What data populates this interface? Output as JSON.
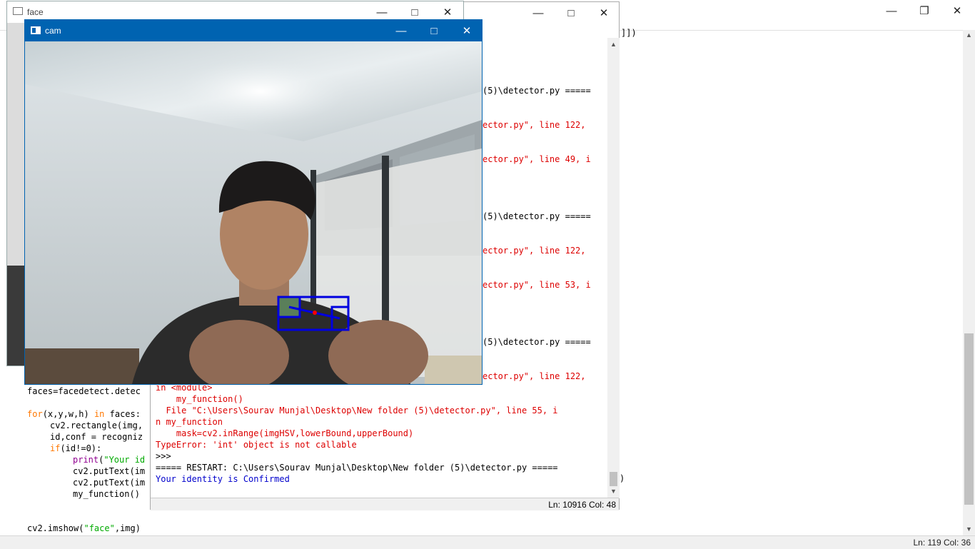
{
  "background_editor": {
    "code_lines": [
      {
        "indent": 0,
        "parts": [
          {
            "t": "faces=facedetect.detec",
            "c": ""
          }
        ]
      },
      {
        "indent": 0,
        "parts": [
          {
            "t": "",
            "c": ""
          }
        ]
      },
      {
        "indent": 0,
        "parts": [
          {
            "t": "for",
            "c": "kw"
          },
          {
            "t": "(x,y,w,h) ",
            "c": ""
          },
          {
            "t": "in",
            "c": "kw"
          },
          {
            "t": " faces:",
            "c": ""
          }
        ]
      },
      {
        "indent": 1,
        "parts": [
          {
            "t": "cv2.rectangle(img,",
            "c": ""
          }
        ]
      },
      {
        "indent": 1,
        "parts": [
          {
            "t": "id,conf = recogniz",
            "c": ""
          }
        ]
      },
      {
        "indent": 1,
        "parts": [
          {
            "t": "if",
            "c": "kw"
          },
          {
            "t": "(id!=0):",
            "c": ""
          }
        ]
      },
      {
        "indent": 2,
        "parts": [
          {
            "t": "print",
            "c": "bi"
          },
          {
            "t": "(",
            "c": ""
          },
          {
            "t": "\"Your id",
            "c": "st"
          }
        ]
      },
      {
        "indent": 2,
        "parts": [
          {
            "t": "cv2.putText(im",
            "c": ""
          }
        ]
      },
      {
        "indent": 2,
        "parts": [
          {
            "t": "cv2.putText(im",
            "c": ""
          }
        ]
      },
      {
        "indent": 2,
        "parts": [
          {
            "t": "my_function()",
            "c": ""
          }
        ]
      },
      {
        "indent": 0,
        "parts": [
          {
            "t": "",
            "c": ""
          }
        ]
      },
      {
        "indent": 0,
        "parts": [
          {
            "t": "",
            "c": ""
          }
        ]
      },
      {
        "indent": 0,
        "parts": [
          {
            "t": "cv2.imshow(",
            "c": ""
          },
          {
            "t": "\"face\"",
            "c": "st"
          },
          {
            "t": ",img)",
            "c": ""
          }
        ]
      }
    ],
    "right_fragment_top": "]])",
    "right_fragment_bottom": ")",
    "status": "Ln: 119   Col: 36"
  },
  "shell": {
    "lines": [
      {
        "t": "(5)\\detector.py =====",
        "c": "",
        "cam_hidden": true
      },
      {
        "t": "",
        "c": ""
      },
      {
        "t": "",
        "c": ""
      },
      {
        "t": "ector.py\", line 122,",
        "c": "red",
        "cam_hidden": true
      },
      {
        "t": "",
        "c": ""
      },
      {
        "t": "",
        "c": ""
      },
      {
        "t": "ector.py\", line 49, i",
        "c": "red",
        "cam_hidden": true
      },
      {
        "t": "",
        "c": ""
      },
      {
        "t": "",
        "c": ""
      },
      {
        "t": "",
        "c": ""
      },
      {
        "t": "",
        "c": ""
      },
      {
        "t": "(5)\\detector.py =====",
        "c": "",
        "cam_hidden": true
      },
      {
        "t": "",
        "c": ""
      },
      {
        "t": "",
        "c": ""
      },
      {
        "t": "ector.py\", line 122,",
        "c": "red",
        "cam_hidden": true
      },
      {
        "t": "",
        "c": ""
      },
      {
        "t": "",
        "c": ""
      },
      {
        "t": "ector.py\", line 53, i",
        "c": "red",
        "cam_hidden": true
      },
      {
        "t": "",
        "c": ""
      },
      {
        "t": "",
        "c": ""
      },
      {
        "t": "",
        "c": ""
      },
      {
        "t": "",
        "c": ""
      },
      {
        "t": "(5)\\detector.py =====",
        "c": "",
        "cam_hidden": true
      },
      {
        "t": "",
        "c": ""
      },
      {
        "t": "",
        "c": ""
      },
      {
        "t": "ector.py\", line 122,",
        "c": "red",
        "cam_hidden": true
      },
      {
        "t": "in <module>",
        "c": "red"
      },
      {
        "t": "    my_function()",
        "c": "red"
      },
      {
        "t": "  File \"C:\\Users\\Sourav Munjal\\Desktop\\New folder (5)\\detector.py\", line 55, i",
        "c": "red"
      },
      {
        "t": "n my_function",
        "c": "red"
      },
      {
        "t": "    mask=cv2.inRange(imgHSV,lowerBound,upperBound)",
        "c": "red"
      },
      {
        "t": "TypeError: 'int' object is not callable",
        "c": "red"
      },
      {
        "t": ">>>",
        "c": ""
      },
      {
        "t": "===== RESTART: C:\\Users\\Sourav Munjal\\Desktop\\New folder (5)\\detector.py =====",
        "c": ""
      },
      {
        "t": "Your identity is Confirmed",
        "c": "blue"
      }
    ],
    "status": "Ln: 10916   Col: 48"
  },
  "face_window": {
    "title": "face"
  },
  "cam_window": {
    "title": "cam"
  },
  "colors": {
    "cam_titlebar": "#0063b1",
    "detection_box": "#0000e0",
    "centroid": "#ff0000"
  }
}
